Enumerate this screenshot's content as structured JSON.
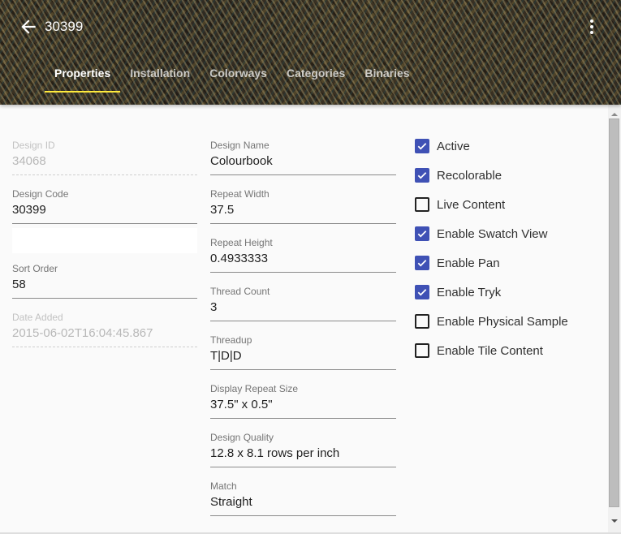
{
  "header": {
    "title": "30399",
    "back_icon": "arrow-left-icon",
    "more_icon": "more-vert-icon",
    "tabs": [
      {
        "label": "Properties",
        "active": true
      },
      {
        "label": "Installation",
        "active": false
      },
      {
        "label": "Colorways",
        "active": false
      },
      {
        "label": "Categories",
        "active": false
      },
      {
        "label": "Binaries",
        "active": false
      }
    ],
    "tab_indicator_color": "#ffeb3b"
  },
  "left_column": {
    "design_id": {
      "label": "Design ID",
      "value": "34068",
      "disabled": true
    },
    "design_code": {
      "label": "Design Code",
      "value": "30399"
    },
    "blank_field": {
      "value": ""
    },
    "sort_order": {
      "label": "Sort Order",
      "value": "58"
    },
    "date_added": {
      "label": "Date Added",
      "value": "2015-06-02T16:04:45.867",
      "disabled": true
    }
  },
  "middle_column": {
    "design_name": {
      "label": "Design Name",
      "value": "Colourbook"
    },
    "repeat_width": {
      "label": "Repeat Width",
      "value": "37.5"
    },
    "repeat_height": {
      "label": "Repeat Height",
      "value": "0.4933333"
    },
    "thread_count": {
      "label": "Thread Count",
      "value": "3"
    },
    "threadup": {
      "label": "Threadup",
      "value": "T|D|D"
    },
    "display_repeat_size": {
      "label": "Display Repeat Size",
      "value": "37.5\" x 0.5\""
    },
    "design_quality": {
      "label": "Design Quality",
      "value": "12.8 x 8.1 rows per inch"
    },
    "match": {
      "label": "Match",
      "value": "Straight"
    }
  },
  "checkboxes": [
    {
      "label": "Active",
      "checked": true
    },
    {
      "label": "Recolorable",
      "checked": true
    },
    {
      "label": "Live Content",
      "checked": false
    },
    {
      "label": "Enable Swatch View",
      "checked": true
    },
    {
      "label": "Enable Pan",
      "checked": true
    },
    {
      "label": "Enable Tryk",
      "checked": true
    },
    {
      "label": "Enable Physical Sample",
      "checked": false
    },
    {
      "label": "Enable Tile Content",
      "checked": false
    }
  ],
  "colors": {
    "checkbox_accent": "#3f51b5"
  }
}
